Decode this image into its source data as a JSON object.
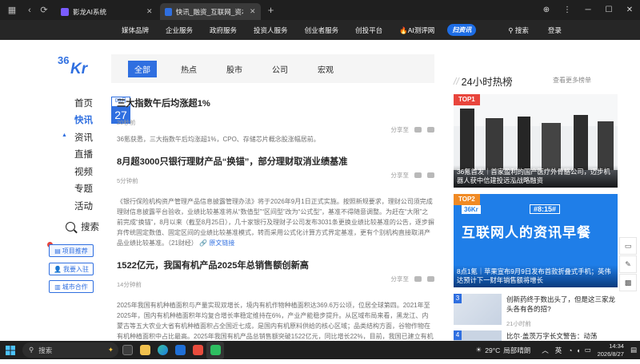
{
  "browser": {
    "tabs": [
      {
        "label": "影龙AI系统",
        "active": false
      },
      {
        "label": "快讯_融资_互联网_资本_科技",
        "active": true
      }
    ]
  },
  "sitenav": {
    "items": [
      "媒体品牌",
      "企业服务",
      "政府服务",
      "投资人服务",
      "创业者服务",
      "创投平台",
      "AI测评网"
    ],
    "live_label": "扫资讯",
    "search_label": "搜索",
    "login_label": "登录"
  },
  "logo": {
    "text": "36Kr"
  },
  "leftmenu": {
    "items": [
      "首页",
      "快讯",
      "资讯",
      "直播",
      "视频",
      "专题",
      "活动"
    ],
    "active_index": 1,
    "search_label": "搜索",
    "buttons": [
      "项目推荐",
      "我要入驻",
      "城市合作"
    ]
  },
  "tabs": {
    "items": [
      "全部",
      "热点",
      "股市",
      "公司",
      "宏观"
    ],
    "active_index": 0
  },
  "date_badge": {
    "month": "08月",
    "day": "27"
  },
  "news": [
    {
      "title": "三大指数午后均涨超1%",
      "time": "20秒前",
      "share": "分享至",
      "body": "36氪获悉，三大指数午后均涨超1%，CPO、存储芯片概念股涨幅居前。"
    },
    {
      "title": "8月超3000只银行理财产品“换锚”，部分理财取消业绩基准",
      "time": "5分钟前",
      "share": "分享至",
      "body": "《银行保险机构资产管理产品信息披露管理办法》将于2026年9月1日正式实施。按照新规要求，理财公司须完成理财信息披露平台验收，业绩比较基准将从“数值型”“区间型”改为“公式型”，基准不得随意调整。为赶在“大限”之前完成“换锚”，8月以来（截至8月25日），几十家银行及理财子公司发布3031条更换业绩比较基准的公告，逐步摒弃传统固定数值、固定区间的业绩比较基准模式，转而采用公式化计算方式界定基准，更有个别机构直接取消产品业绩比较基准。（21财经）",
      "link": "原文链接"
    },
    {
      "title": "1522亿元，我国有机产品2025年总销售额创新高",
      "time": "14分钟前",
      "share": "分享至",
      "body": "2025年我国有机种植面积与产量实现双增长，境内有机作物种植面积达369.6万公顷，位居全球第四。2021年至2025年，国内有机种植面积年均复合增长率稳定维持在6%，产业产能稳步提升。从区域布局来看，黑龙江、内蒙古等五大农业大省有机种植面积占全国近七成，是国内有机原料供给的核心区域；品类结构方面，谷物作物在有机种植面积中占比最高。2025年我国有机产品总销售额突破1522亿元，同比增长22%，目前，我国已建立有机产品认证制度，实施统一的国家标准、认证规则、"
    }
  ],
  "hot": {
    "title": "24小时热榜",
    "more": "查看更多榜单",
    "cards": [
      {
        "rank": "TOP1",
        "caption": "36氪首发｜首家盈利的国产医疗外骨骼公司，迈步机器人获中信建投远泓战略融资"
      },
      {
        "rank": "TOP2",
        "brand": "36Kr",
        "time_tag": "#8:15#",
        "headline": "互联网人的资讯早餐",
        "caption": "8点1氪｜苹果宣布9月9日发布首款折叠式手机；英伟达预计下一财年销售额将增长"
      }
    ],
    "items": [
      {
        "num": "3",
        "text": "创新药终于数出头了，但是这三家龙头各有各的招?",
        "ago": "21小时前"
      },
      {
        "num": "4",
        "text": "比尔·盖茨万字长文警告：动荡",
        "ago": ""
      }
    ]
  },
  "taskbar": {
    "search_label": "搜索",
    "weather": "29°C",
    "weather_desc": "局部晴朗",
    "ime": "英",
    "time": "14:34",
    "date": "2026/8/27"
  }
}
